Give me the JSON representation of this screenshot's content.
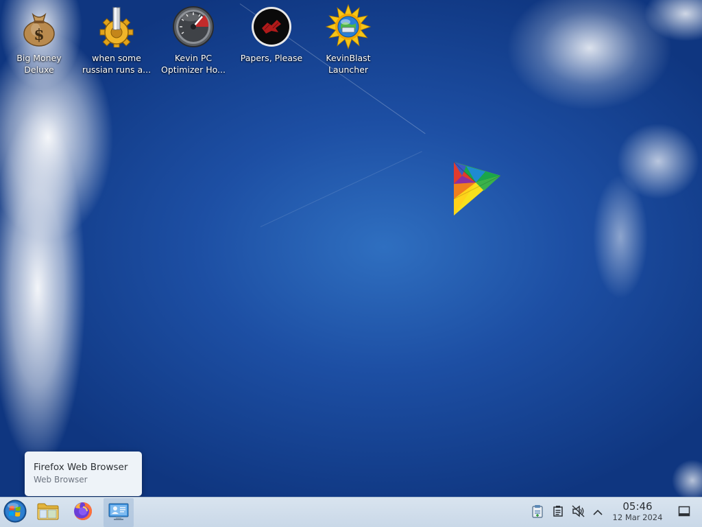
{
  "desktop": {
    "icons": [
      {
        "line1": "Big Money",
        "line2": "Deluxe",
        "icon": "money-bag-icon"
      },
      {
        "line1": "when some",
        "line2": "russian runs a...",
        "icon": "gear-icon"
      },
      {
        "line1": "Kevin PC",
        "line2": "Optimizer Ho...",
        "icon": "speedometer-icon"
      },
      {
        "line1": "Papers, Please",
        "line2": "",
        "icon": "papers-please-icon"
      },
      {
        "line1": "KevinBlast",
        "line2": "Launcher",
        "icon": "sun-globe-icon"
      }
    ]
  },
  "tooltip": {
    "title": "Firefox Web Browser",
    "subtitle": "Web Browser"
  },
  "taskbar": {
    "start_icon": "windows-start-icon",
    "pinned": [
      {
        "icon": "folder-icon"
      },
      {
        "icon": "firefox-icon"
      },
      {
        "icon": "system-settings-icon"
      }
    ],
    "tray": [
      {
        "icon": "clipboard-icon"
      },
      {
        "icon": "notes-icon"
      },
      {
        "icon": "volume-muted-icon"
      },
      {
        "icon": "chevron-up-icon"
      }
    ],
    "clock": {
      "time": "05:46",
      "date": "12 Mar 2024"
    },
    "show_desktop_icon": "show-desktop-icon"
  },
  "colors": {
    "sky_dark": "#0f3680",
    "sky_light": "#2f6fc0",
    "taskbar": "#d3e0ed",
    "tooltip_bg": "#eef3f8",
    "firefox_orange": "#ff7139"
  }
}
